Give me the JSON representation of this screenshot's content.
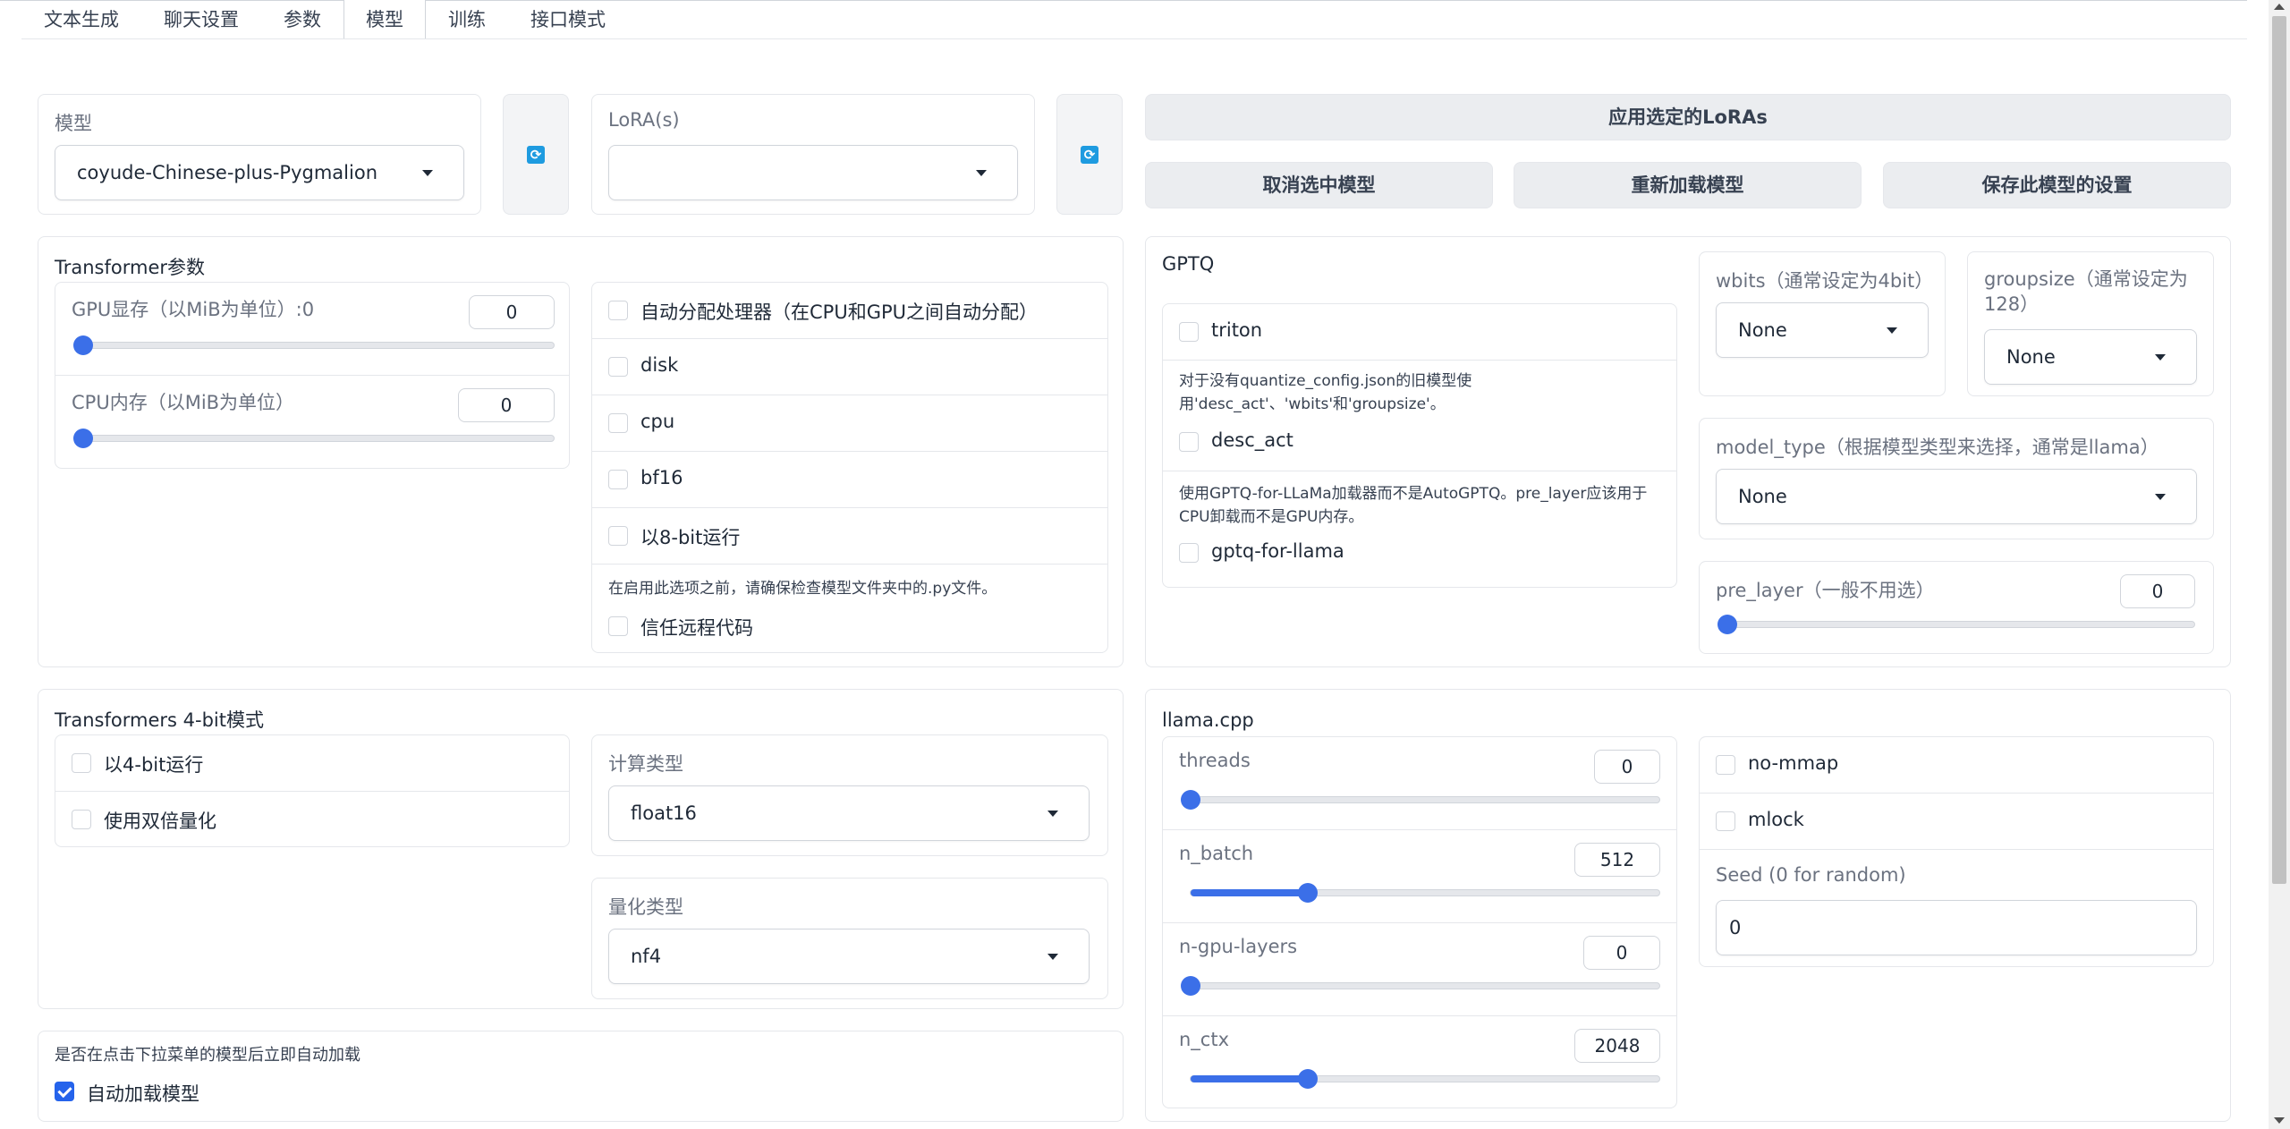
{
  "tabs": [
    "文本生成",
    "聊天设置",
    "参数",
    "模型",
    "训练",
    "接口模式"
  ],
  "model": {
    "label": "模型",
    "value": "coyude-Chinese-plus-Pygmalion"
  },
  "lora": {
    "label": "LoRA(s)",
    "value": ""
  },
  "buttons": {
    "apply_loras": "应用选定的LoRAs",
    "unload": "取消选中模型",
    "reload": "重新加载模型",
    "save": "保存此模型的设置"
  },
  "transformer": {
    "title": "Transformer参数",
    "gpu_mem": {
      "label": "GPU显存（以MiB为单位）:0",
      "value": "0",
      "fraction": 0
    },
    "cpu_mem": {
      "label": "CPU内存（以MiB为单位）",
      "value": "0",
      "fraction": 0
    },
    "options": [
      "自动分配处理器（在CPU和GPU之间自动分配）",
      "disk",
      "cpu",
      "bf16",
      "以8-bit运行"
    ],
    "trust_info": "在启用此选项之前，请确保检查模型文件夹中的.py文件。",
    "trust_label": "信任远程代码"
  },
  "gptq": {
    "title": "GPTQ",
    "triton": "triton",
    "desc_act_info": "对于没有quantize_config.json的旧模型使用'desc_act'、'wbits'和'groupsize'。",
    "desc_act": "desc_act",
    "gptq_info": "使用GPTQ-for-LLaMa加载器而不是AutoGPTQ。pre_layer应该用于CPU卸载而不是GPU内存。",
    "gptq_for_llama": "gptq-for-llama",
    "wbits": {
      "label": "wbits（通常设定为4bit）",
      "value": "None"
    },
    "groupsize": {
      "label": "groupsize（通常设定为128）",
      "value": "None"
    },
    "model_type": {
      "label": "model_type（根据模型类型来选择，通常是llama）",
      "value": "None"
    },
    "pre_layer": {
      "label": "pre_layer（一般不用选）",
      "value": "0",
      "fraction": 0
    }
  },
  "bit4": {
    "title": "Transformers 4-bit模式",
    "load_4bit": "以4-bit运行",
    "double_quant": "使用双倍量化",
    "compute_dtype": {
      "label": "计算类型",
      "value": "float16"
    },
    "quant_type": {
      "label": "量化类型",
      "value": "nf4"
    }
  },
  "autoload": {
    "info": "是否在点击下拉菜单的模型后立即自动加载",
    "label": "自动加载模型",
    "checked": true
  },
  "llama": {
    "title": "llama.cpp",
    "threads": {
      "label": "threads",
      "value": "0",
      "fraction": 0
    },
    "n_batch": {
      "label": "n_batch",
      "value": "512",
      "fraction": 0.25
    },
    "n_gpu_layers": {
      "label": "n-gpu-layers",
      "value": "0",
      "fraction": 0
    },
    "n_ctx": {
      "label": "n_ctx",
      "value": "2048",
      "fraction": 0.25
    },
    "no_mmap": "no-mmap",
    "mlock": "mlock",
    "seed": {
      "label": "Seed (0 for random)",
      "value": "0"
    }
  },
  "colors": {
    "accent": "#3b6fe8",
    "checkbox_on": "#2563eb"
  }
}
